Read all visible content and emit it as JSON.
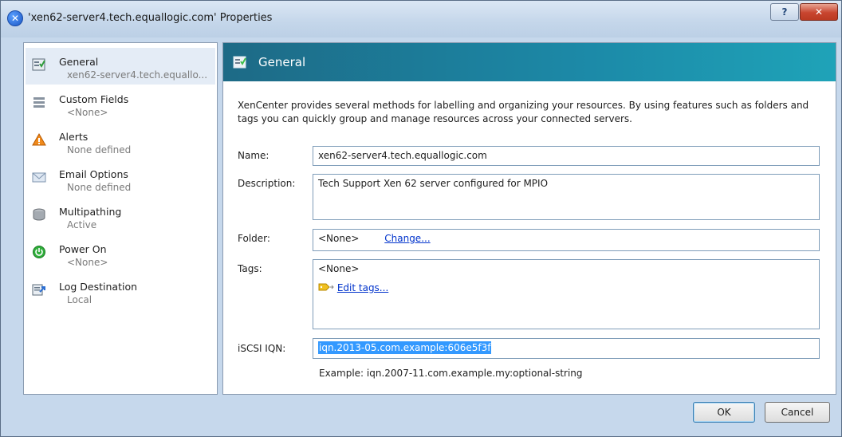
{
  "window": {
    "title": "'xen62-server4.tech.equallogic.com' Properties",
    "help_label": "?",
    "close_label": "✕"
  },
  "nav": {
    "items": [
      {
        "label": "General",
        "sub": "xen62-server4.tech.equallo...",
        "icon": "general-icon",
        "selected": true
      },
      {
        "label": "Custom Fields",
        "sub": "<None>",
        "icon": "custom-fields-icon"
      },
      {
        "label": "Alerts",
        "sub": "None defined",
        "icon": "alert-icon"
      },
      {
        "label": "Email Options",
        "sub": "None defined",
        "icon": "email-icon"
      },
      {
        "label": "Multipathing",
        "sub": "Active",
        "icon": "multipathing-icon"
      },
      {
        "label": "Power On",
        "sub": "<None>",
        "icon": "power-icon"
      },
      {
        "label": "Log Destination",
        "sub": "Local",
        "icon": "log-destination-icon"
      }
    ]
  },
  "content": {
    "header_title": "General",
    "intro": "XenCenter provides several methods for labelling and organizing your resources. By using features such as folders and tags you can quickly group and manage resources across your connected servers.",
    "name_label": "Name:",
    "name_value": "xen62-server4.tech.equallogic.com",
    "description_label": "Description:",
    "description_value": "Tech Support Xen 62 server configured for MPIO",
    "folder_label": "Folder:",
    "folder_value": "<None>",
    "folder_change": "Change...",
    "tags_label": "Tags:",
    "tags_value": "<None>",
    "tags_edit": "Edit tags...",
    "iqn_label": "iSCSI IQN:",
    "iqn_value": "iqn.2013-05.com.example:606e5f3f",
    "iqn_example": "Example: iqn.2007-11.com.example.my:optional-string"
  },
  "buttons": {
    "ok": "OK",
    "cancel": "Cancel"
  },
  "colors": {
    "header_gradient_start": "#1d6a86",
    "header_gradient_end": "#1fa3b8",
    "selection": "#3399ff",
    "link": "#0033cc"
  }
}
